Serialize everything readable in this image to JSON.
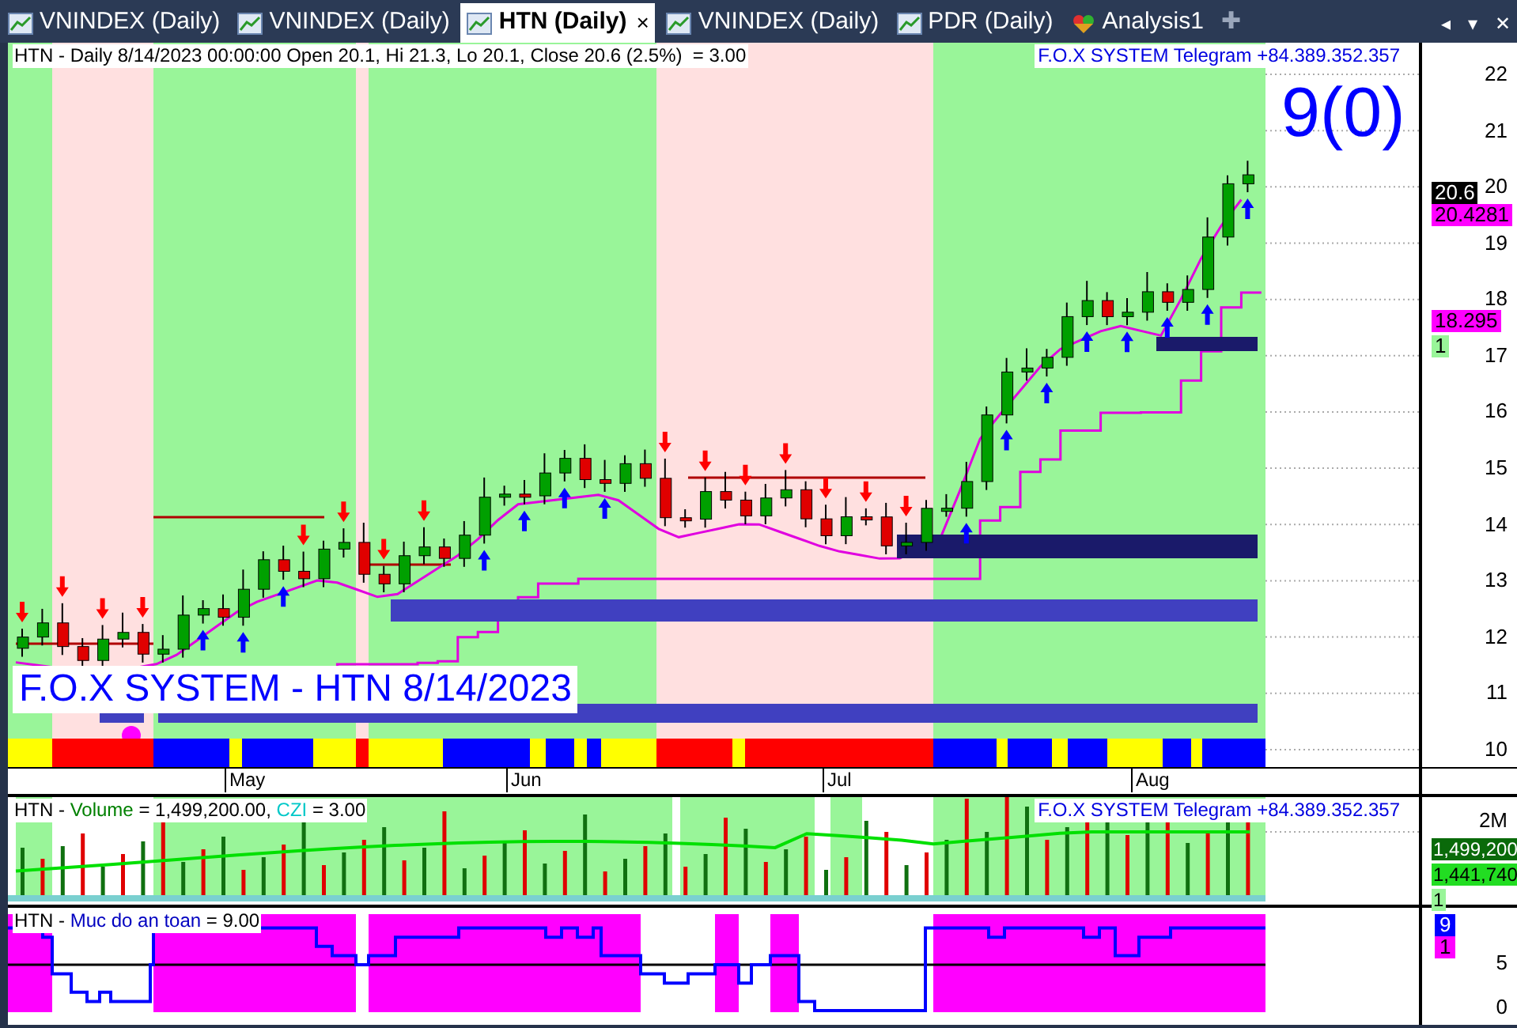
{
  "tabs": [
    {
      "label": "VNINDEX (Daily)",
      "kind": "chart",
      "selected": false
    },
    {
      "label": "VNINDEX (Daily)",
      "kind": "chart",
      "selected": false
    },
    {
      "label": "HTN (Daily)",
      "kind": "chart",
      "selected": true,
      "close": "×"
    },
    {
      "label": "VNINDEX (Daily)",
      "kind": "chart",
      "selected": false
    },
    {
      "label": "PDR (Daily)",
      "kind": "chart",
      "selected": false
    },
    {
      "label": "Analysis1",
      "kind": "analysis",
      "selected": false
    }
  ],
  "add_tab": "✚",
  "tab_controls": [
    "◂",
    "▾",
    "✕"
  ],
  "price_panel": {
    "header": "HTN - Daily 8/14/2023 00:00:00 Open 20.1, Hi 21.3, Lo 20.1, Close 20.6 (2.5%)  = 3.00",
    "telegram": "F.O.X SYSTEM Telegram +84.389.352.357",
    "overlay_label": "F.O.X SYSTEM - HTN 8/14/2023",
    "signal": "9(0)",
    "y_axis": [
      "22",
      "21",
      "20",
      "19",
      "18",
      "17",
      "16",
      "15",
      "14",
      "13",
      "12",
      "11",
      "10"
    ],
    "price_tags": [
      {
        "text": "20.6",
        "kind": "last"
      },
      {
        "text": "20.4281",
        "kind": "level"
      },
      {
        "text": "18.295",
        "kind": "level"
      },
      {
        "text": "1",
        "kind": "count"
      }
    ],
    "months": [
      "May",
      "Jun",
      "Jul",
      "Aug"
    ]
  },
  "volume_panel": {
    "header": [
      {
        "text": "HTN - ",
        "kind": "plain"
      },
      {
        "text": "Volume",
        "kind": "volume"
      },
      {
        "text": " = 1,499,200.00, ",
        "kind": "plain"
      },
      {
        "text": "CZI",
        "kind": "czi"
      },
      {
        "text": " = 3.00",
        "kind": "plain"
      }
    ],
    "telegram": "F.O.X SYSTEM Telegram +84.389.352.357",
    "y_axis": [
      "2M"
    ],
    "tags": [
      {
        "text": "1,499,200",
        "kind": "volume"
      },
      {
        "text": "1,441,740",
        "kind": "average"
      },
      {
        "text": "1",
        "kind": "count"
      }
    ]
  },
  "safety_panel": {
    "header": [
      {
        "text": "HTN - ",
        "kind": "plain"
      },
      {
        "text": "Muc do an toan",
        "kind": "volume"
      },
      {
        "text": " = 9.00",
        "kind": "plain"
      }
    ],
    "tags": [
      {
        "text": "9",
        "kind": "value"
      },
      {
        "text": "1",
        "kind": "count"
      }
    ],
    "y_axis": [
      "5",
      "0"
    ]
  }
}
